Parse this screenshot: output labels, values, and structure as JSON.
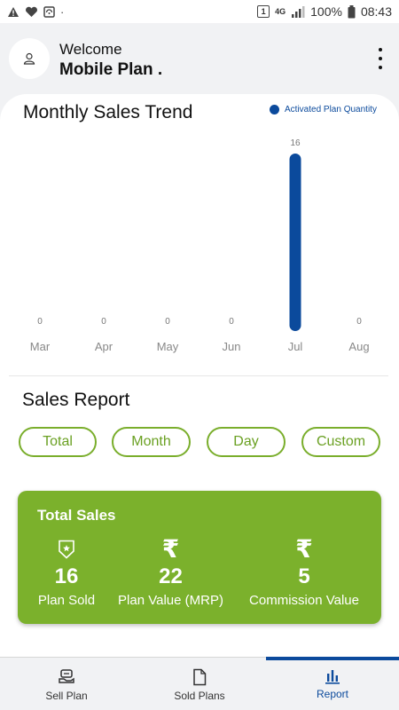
{
  "status_bar": {
    "left_icons": [
      "warning-icon",
      "heart-icon",
      "sim-icon",
      "dot-icon"
    ],
    "network_label": "4G",
    "battery_percent": "100%",
    "time": "08:43",
    "sim_label": "1"
  },
  "header": {
    "welcome": "Welcome",
    "username": "Mobile Plan ."
  },
  "chart_section": {
    "title": "Monthly Sales Trend",
    "legend_label": "Activated Plan Quantity",
    "accent_color": "#0b4a9c"
  },
  "chart_data": {
    "type": "bar",
    "title": "Monthly Sales Trend",
    "categories": [
      "Mar",
      "Apr",
      "May",
      "Jun",
      "Jul",
      "Aug"
    ],
    "series": [
      {
        "name": "Activated Plan Quantity",
        "values": [
          0,
          0,
          0,
          0,
          16,
          0
        ]
      }
    ],
    "ylim": [
      0,
      16
    ],
    "grid": false,
    "legend": "top-right",
    "color": "#0b4a9c"
  },
  "sales_report": {
    "title": "Sales Report",
    "filters": [
      {
        "label": "Total",
        "active": true
      },
      {
        "label": "Month",
        "active": false
      },
      {
        "label": "Day",
        "active": false
      },
      {
        "label": "Custom",
        "active": false
      }
    ]
  },
  "total_sales": {
    "title": "Total Sales",
    "card_color": "#7bb12c",
    "stats": [
      {
        "icon": "badge-icon",
        "value": "16",
        "label": "Plan Sold"
      },
      {
        "icon": "rupee-icon",
        "glyph": "₹",
        "value": "22",
        "label": "Plan Value (MRP)"
      },
      {
        "icon": "rupee-icon",
        "glyph": "₹",
        "value": "5",
        "label": "Commission Value"
      }
    ]
  },
  "bottom_nav": {
    "items": [
      {
        "label": "Sell Plan",
        "icon": "sell-plan-icon",
        "active": false
      },
      {
        "label": "Sold Plans",
        "icon": "document-icon",
        "active": false
      },
      {
        "label": "Report",
        "icon": "bar-chart-icon",
        "active": true
      }
    ]
  }
}
